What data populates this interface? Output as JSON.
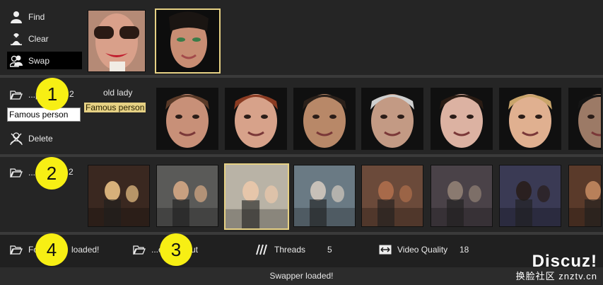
{
  "actions": {
    "find": "Find",
    "clear": "Clear",
    "swap": "Swap"
  },
  "faces_row": {
    "load_label": "...p",
    "count": "2",
    "name_input_value": "Famous person",
    "tag_old": "old lady",
    "tag_famous": "Famous person",
    "delete": "Delete"
  },
  "media_row": {
    "load_label": "...u",
    "count": "2"
  },
  "bottom_bar": {
    "folder_label": "Fo",
    "folder_tail": "loaded!",
    "output_label": "...e",
    "output_tail": "ut",
    "threads_label": "Threads",
    "threads_value": "5",
    "video_quality_label": "Video Quality",
    "video_quality_value": "18"
  },
  "status": "Swapper loaded!",
  "watermark": {
    "main": "Discuz!",
    "sub": "换脸社区 znztv.cn"
  },
  "callouts": [
    "1",
    "2",
    "3",
    "4"
  ],
  "colors": {
    "accent": "#e6d184",
    "callout": "#f7ef14"
  }
}
